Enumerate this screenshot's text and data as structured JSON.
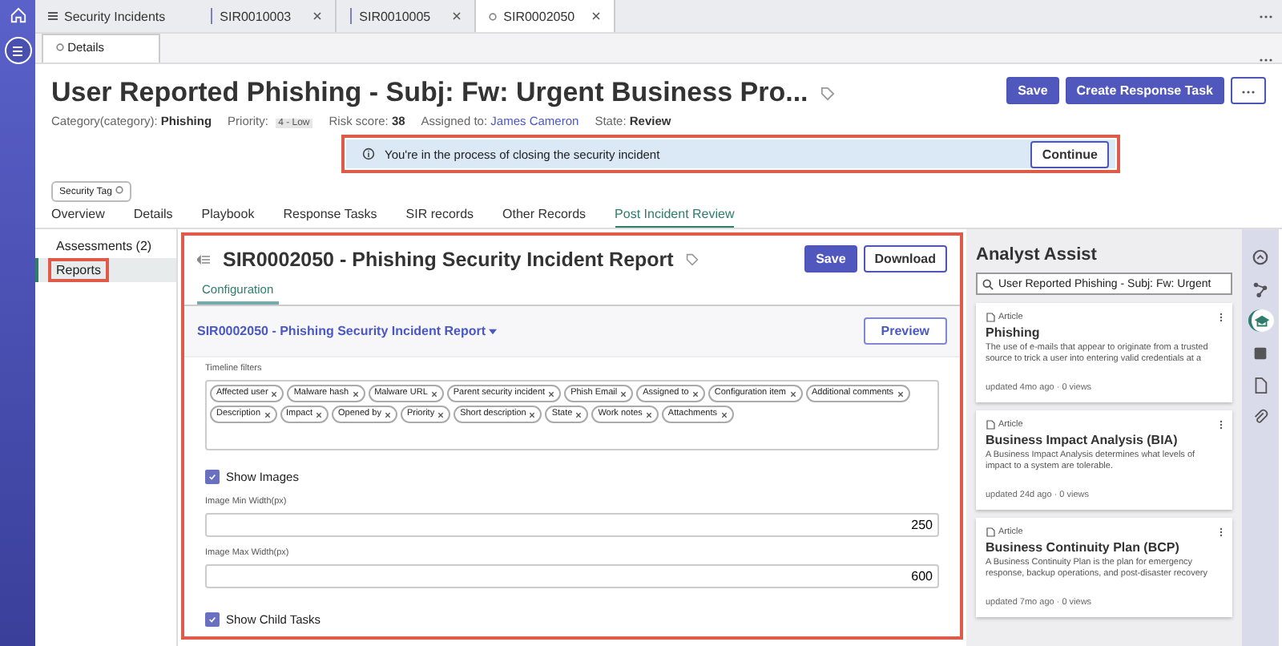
{
  "app_tabs": [
    {
      "kind": "list",
      "label": "Security Incidents",
      "selected": false
    },
    {
      "kind": "record",
      "label": "SIR0010003",
      "selected": false
    },
    {
      "kind": "record",
      "label": "SIR0010005",
      "selected": false
    },
    {
      "kind": "record",
      "label": "SIR0002050",
      "selected": true
    }
  ],
  "sub_tabs": [
    {
      "label": "Details",
      "selected": true
    }
  ],
  "record": {
    "title": "User Reported Phishing - Subj: Fw: Urgent Business Pro...",
    "actions": [
      "Save",
      "Create Response Task"
    ],
    "meta": [
      {
        "kind": "text",
        "label": "Category(category):",
        "value": "Phishing"
      },
      {
        "kind": "badge",
        "label": "Priority:",
        "value": "4 - Low"
      },
      {
        "kind": "text",
        "label": "Risk score:",
        "value": "38"
      },
      {
        "kind": "link",
        "label": "Assigned to:",
        "value": "James Cameron"
      },
      {
        "kind": "text",
        "label": "State:",
        "value": "Review"
      }
    ]
  },
  "banner": {
    "message": "You're in the process of closing the security incident",
    "button": "Continue",
    "highlighted": true
  },
  "security_tag": "Security Tag",
  "section_tabs": [
    {
      "label": "Overview",
      "selected": false
    },
    {
      "label": "Details",
      "selected": false
    },
    {
      "label": "Playbook",
      "selected": false
    },
    {
      "label": "Response Tasks",
      "selected": false
    },
    {
      "label": "SIR records",
      "selected": false
    },
    {
      "label": "Other Records",
      "selected": false
    },
    {
      "label": "Post Incident Review",
      "selected": true
    }
  ],
  "side_nav": [
    {
      "label": "Assessments (2)",
      "selected": false,
      "highlighted": false
    },
    {
      "label": "Reports",
      "selected": true,
      "highlighted": true
    }
  ],
  "report": {
    "title": "SIR0002050 - Phishing Security Incident Report",
    "highlighted": true,
    "buttons": [
      {
        "label": "Save",
        "primary": true
      },
      {
        "label": "Download",
        "primary": false
      }
    ],
    "tabs": [
      {
        "label": "Configuration",
        "selected": true
      }
    ],
    "template": "SIR0002050 - Phishing Security Incident Report",
    "preview": "Preview",
    "filters_label": "Timeline filters",
    "filters": [
      "Affected user",
      "Malware hash",
      "Malware URL",
      "Parent security incident",
      "Phish Email",
      "Assigned to",
      "Configuration item",
      "Additional comments",
      "Description",
      "Impact",
      "Opened by",
      "Priority",
      "Short description",
      "State",
      "Work notes",
      "Attachments"
    ],
    "options": [
      {
        "kind": "checkbox",
        "label": "Show Images",
        "checked": true
      },
      {
        "kind": "number",
        "label": "Image Min Width(px)",
        "value": "250"
      },
      {
        "kind": "number",
        "label": "Image Max Width(px)",
        "value": "600"
      },
      {
        "kind": "checkbox",
        "label": "Show Child Tasks",
        "checked": true
      }
    ]
  },
  "analyst_assist": {
    "title": "Analyst Assist",
    "search": "User Reported Phishing - Subj: Fw: Urgent",
    "articles": [
      {
        "type": "Article",
        "title": "Phishing",
        "summary": "The use of e-mails that appear to originate from a trusted source to trick a user into entering valid credentials at a",
        "meta": "updated 4mo ago · 0 views"
      },
      {
        "type": "Article",
        "title": "Business Impact Analysis (BIA)",
        "summary": "A Business Impact Analysis determines what levels of impact to a system are tolerable.",
        "meta": "updated 24d ago · 0 views"
      },
      {
        "type": "Article",
        "title": "Business Continuity Plan (BCP)",
        "summary": "A Business Continuity Plan is the plan for emergency response, backup operations, and post-disaster recovery",
        "meta": "updated 7mo ago · 0 views"
      }
    ]
  },
  "right_rail": [
    {
      "selected": false
    },
    {
      "selected": false
    },
    {
      "selected": true
    },
    {
      "selected": false
    },
    {
      "selected": false
    },
    {
      "selected": false
    }
  ]
}
